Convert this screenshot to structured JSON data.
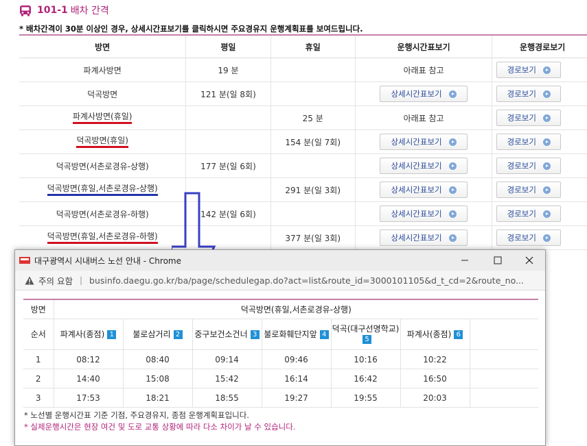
{
  "page": {
    "title_num": "101-1",
    "title_text": "배차 간격",
    "notice": "* 배차간격이 30분 이상인 경우, 상세시간표보기를 클릭하시면 주요경유지 운행계획표를 보여드립니다.",
    "headers": [
      "방면",
      "평일",
      "휴일",
      "운행시간표보기",
      "운행경로보기"
    ],
    "rows": [
      {
        "dir": "파계사방면",
        "weekday": "19 분",
        "holiday": "",
        "sched": "아래표 참고",
        "route": "경로보기"
      },
      {
        "dir": "덕곡방면",
        "weekday": "121 분(일 8회)",
        "holiday": "",
        "sched": "상세시간표보기",
        "route": "경로보기"
      },
      {
        "dir": "파계사방면(휴일)",
        "weekday": "",
        "holiday": "25 분",
        "sched": "아래표 참고",
        "route": "경로보기"
      },
      {
        "dir": "덕곡방면(휴일)",
        "weekday": "",
        "holiday": "154 분(일 7회)",
        "sched": "상세시간표보기",
        "route": "경로보기"
      },
      {
        "dir": "덕곡방면(서촌로경유-상행)",
        "weekday": "177 분(일 6회)",
        "holiday": "",
        "sched": "상세시간표보기",
        "route": "경로보기"
      },
      {
        "dir": "덕곡방면(휴일,서촌로경유-상행)",
        "weekday": "",
        "holiday": "291 분(일 3회)",
        "sched": "상세시간표보기",
        "route": "경로보기"
      },
      {
        "dir": "덕곡방면(서촌로경유-하행)",
        "weekday": "142 분(일 6회)",
        "holiday": "",
        "sched": "상세시간표보기",
        "route": "경로보기"
      },
      {
        "dir": "덕곡방면(휴일,서촌로경유-하행)",
        "weekday": "",
        "holiday": "377 분(일 3회)",
        "sched": "상세시간표보기",
        "route": "경로보기"
      }
    ]
  },
  "popup": {
    "window_title": "대구광역시 시내버스 노선 안내 - Chrome",
    "addr_warning": "주의 요함",
    "addr_url": "businfo.daegu.go.kr/ba/page/schedulegap.do?act=list&route_id=3000101105&d_t_cd=2&route_no...",
    "dir_label": "방면",
    "dir_value": "덕곡방면(휴일,서촌로경유-상행)",
    "seq_label": "순서",
    "stops": [
      {
        "name": "파계사(종점)",
        "n": "1"
      },
      {
        "name": "불로삼거리",
        "n": "2"
      },
      {
        "name": "중구보건소건너",
        "n": "3"
      },
      {
        "name": "불로화훼단지앞",
        "n": "4"
      },
      {
        "name": "덕곡(대구선명학교)",
        "n": "5"
      },
      {
        "name": "파계사(종점)",
        "n": "6"
      }
    ],
    "trips": [
      {
        "seq": "1",
        "times": [
          "08:12",
          "08:40",
          "09:14",
          "09:46",
          "10:16",
          "10:22"
        ]
      },
      {
        "seq": "2",
        "times": [
          "14:40",
          "15:08",
          "15:42",
          "16:14",
          "16:42",
          "16:50"
        ]
      },
      {
        "seq": "3",
        "times": [
          "17:53",
          "18:21",
          "18:55",
          "19:27",
          "19:55",
          "20:03"
        ]
      }
    ],
    "foot1": "* 노선별 운행시간표 기준 기점, 주요경유지, 종점 운행계획표입니다.",
    "foot2": "* 실제운행시간은 현장 여건 및 도로 교통 상황에 따라 다소 차이가 날 수 있습니다."
  },
  "colors": {
    "accent": "#b0237a",
    "underline_red": "#d01020",
    "underline_blue": "#2233aa",
    "arrow_blue": "#3a3fc4",
    "stop_badge": "#1e90d6"
  }
}
